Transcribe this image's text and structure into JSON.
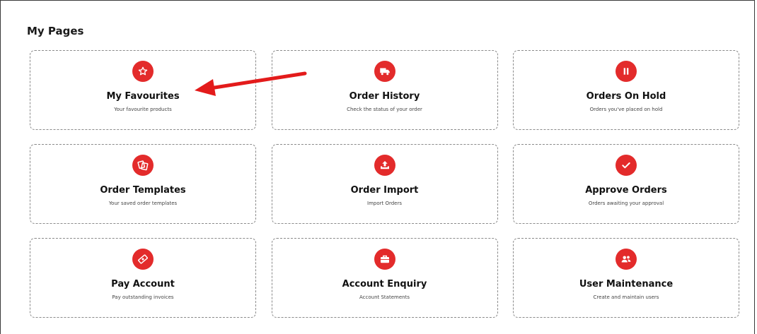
{
  "page": {
    "title": "My Pages"
  },
  "colors": {
    "accent": "#e32b2b",
    "card_border": "#8a8a8a",
    "annotation_arrow": "#e31b1b"
  },
  "cards": [
    {
      "title": "My Favourites",
      "subtitle": "Your favourite products",
      "icon": "star-icon"
    },
    {
      "title": "Order History",
      "subtitle": "Check the status of your order",
      "icon": "truck-icon"
    },
    {
      "title": "Orders On Hold",
      "subtitle": "Orders you've placed on hold",
      "icon": "pause-icon"
    },
    {
      "title": "Order Templates",
      "subtitle": "Your saved order templates",
      "icon": "templates-icon"
    },
    {
      "title": "Order Import",
      "subtitle": "Import Orders",
      "icon": "upload-icon"
    },
    {
      "title": "Approve Orders",
      "subtitle": "Orders awaiting your approval",
      "icon": "check-icon"
    },
    {
      "title": "Pay Account",
      "subtitle": "Pay outstanding invoices",
      "icon": "money-icon"
    },
    {
      "title": "Account Enquiry",
      "subtitle": "Account Statements",
      "icon": "briefcase-icon"
    },
    {
      "title": "User Maintenance",
      "subtitle": "Create and maintain users",
      "icon": "users-icon"
    }
  ]
}
